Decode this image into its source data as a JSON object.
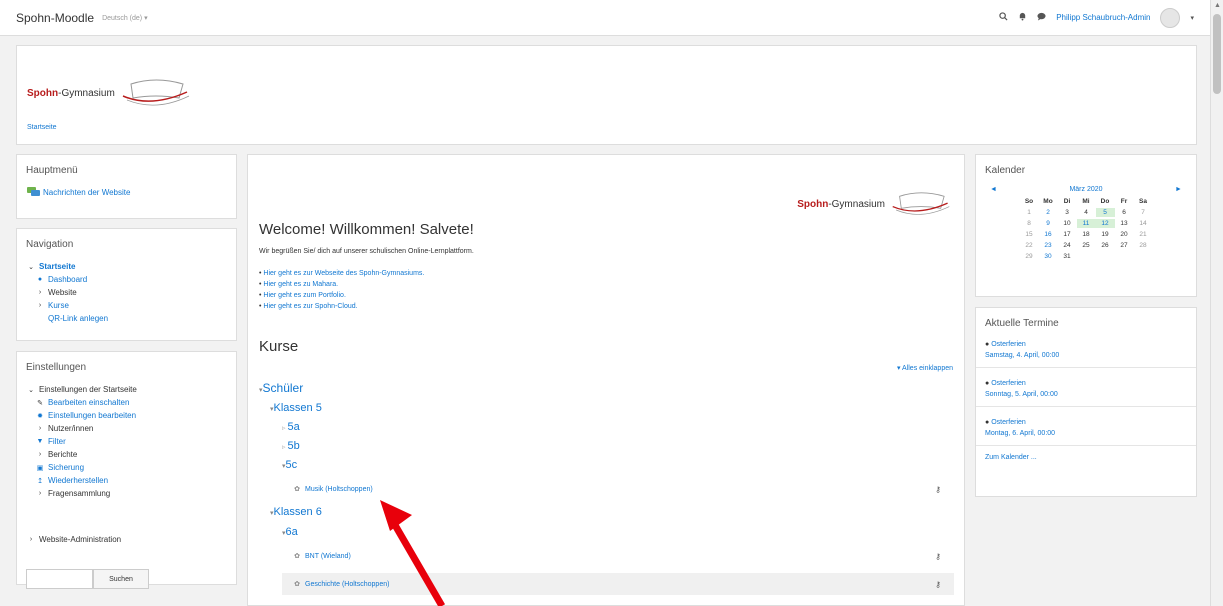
{
  "topbar": {
    "brand": "Spohn-Moodle",
    "lang": "Deutsch (de) ▾",
    "user": "Philipp Schaubruch-Admin",
    "search_icon": "search-icon",
    "bell_icon": "bell-icon",
    "chat_icon": "chat-icon"
  },
  "header": {
    "logo_red": "Spohn",
    "logo_rest": "-Gymnasium",
    "breadcrumb": "Startseite"
  },
  "mainmenu": {
    "title": "Hauptmenü",
    "item": "Nachrichten der Website"
  },
  "navigation": {
    "title": "Navigation",
    "items": [
      "Startseite",
      "Dashboard",
      "Website",
      "Kurse",
      "QR-Link anlegen"
    ]
  },
  "settings": {
    "title": "Einstellungen",
    "items": [
      "Einstellungen der Startseite",
      "Bearbeiten einschalten",
      "Einstellungen bearbeiten",
      "Nutzer/innen",
      "Filter",
      "Berichte",
      "Sicherung",
      "Wiederherstellen",
      "Fragensammlung"
    ]
  },
  "siteadmin": {
    "label": "Website-Administration",
    "search_button": "Suchen"
  },
  "main": {
    "logo_red": "Spohn",
    "logo_rest": "-Gymnasium",
    "welcome": "Welcome! Willkommen! Salvete!",
    "intro": "Wir begrüßen Sie/ dich auf unserer schulischen Online-Lernplattform.",
    "links": [
      "Hier geht es zur Webseite des Spohn-Gymnasiums.",
      "Hier geht es zu Mahara.",
      "Hier geht es zum Portfolio.",
      "Hier geht es zur Spohn-Cloud."
    ],
    "kurse_title": "Kurse",
    "collapse": "Alles einklappen",
    "categories": [
      "Schüler",
      "Klassen 5",
      "5a",
      "5b",
      "5c",
      "Klassen 6",
      "6a"
    ],
    "courses": [
      "Musik (Holtschoppen)",
      "BNT (Wieland)",
      "Geschichte (Holtschoppen)"
    ]
  },
  "calendar": {
    "title": "Kalender",
    "month": "März 2020",
    "prev": "◄",
    "next": "►",
    "days": [
      "So",
      "Mo",
      "Di",
      "Mi",
      "Do",
      "Fr",
      "Sa"
    ],
    "weeks": [
      [
        "1",
        "2",
        "3",
        "4",
        "5",
        "6",
        "7"
      ],
      [
        "8",
        "9",
        "10",
        "11",
        "12",
        "13",
        "14"
      ],
      [
        "15",
        "16",
        "17",
        "18",
        "19",
        "20",
        "21"
      ],
      [
        "22",
        "23",
        "24",
        "25",
        "26",
        "27",
        "28"
      ],
      [
        "29",
        "30",
        "31",
        "",
        "",
        "",
        ""
      ]
    ],
    "highlighted": [
      "5",
      "11",
      "12"
    ],
    "link_days": [
      "2",
      "9",
      "16",
      "23",
      "30",
      "5",
      "11",
      "12"
    ]
  },
  "events": {
    "title": "Aktuelle Termine",
    "items": [
      {
        "name": "Osterferien",
        "date": "Samstag, 4. April, 00:00"
      },
      {
        "name": "Osterferien",
        "date": "Sonntag, 5. April, 00:00"
      },
      {
        "name": "Osterferien",
        "date": "Montag, 6. April, 00:00"
      }
    ],
    "more": "Zum Kalender ..."
  },
  "colors": {
    "link": "#1177d1",
    "highlight": "#d7f0d7",
    "annotation_arrow": "#e8000b"
  }
}
